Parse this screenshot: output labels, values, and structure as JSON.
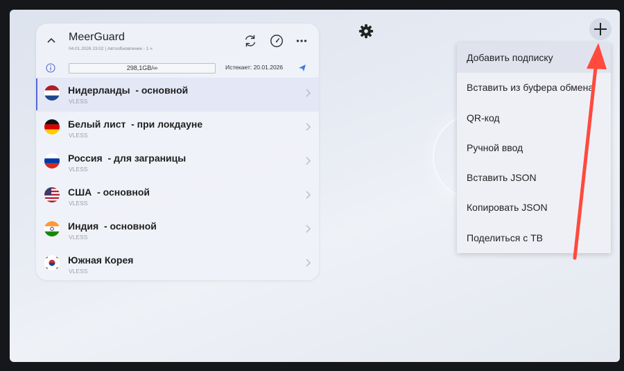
{
  "profile": {
    "title": "MeerGuard",
    "subtitle": "04.01.2026 23:02 | Автообновление - 1 ч",
    "traffic": "298,1GB/∞",
    "expires": "Истекает: 20.01.2026"
  },
  "header_icons": [
    "refresh-icon",
    "speedometer-icon",
    "more-icon"
  ],
  "servers": [
    {
      "name": "Нидерланды  - основной",
      "protocol": "VLESS",
      "flag": "nl",
      "active": true
    },
    {
      "name": "Белый лист  - при локдауне",
      "protocol": "VLESS",
      "flag": "de",
      "active": false
    },
    {
      "name": "Россия  - для заграницы",
      "protocol": "VLESS",
      "flag": "ru",
      "active": false
    },
    {
      "name": "США  - основной",
      "protocol": "VLESS",
      "flag": "us",
      "active": false
    },
    {
      "name": "Индия  - основной",
      "protocol": "VLESS",
      "flag": "in",
      "active": false
    },
    {
      "name": "Южная Корея",
      "protocol": "VLESS",
      "flag": "kr",
      "active": false
    }
  ],
  "menu": {
    "items": [
      "Добавить подписку",
      "Вставить из буфера обмена",
      "QR-код",
      "Ручной ввод",
      "Вставить JSON",
      "Копировать JSON",
      "Поделиться с ТВ"
    ]
  },
  "colors": {
    "accent": "#5567d6",
    "send": "#3b7fe0",
    "annotation_arrow": "#ff4a3d"
  }
}
